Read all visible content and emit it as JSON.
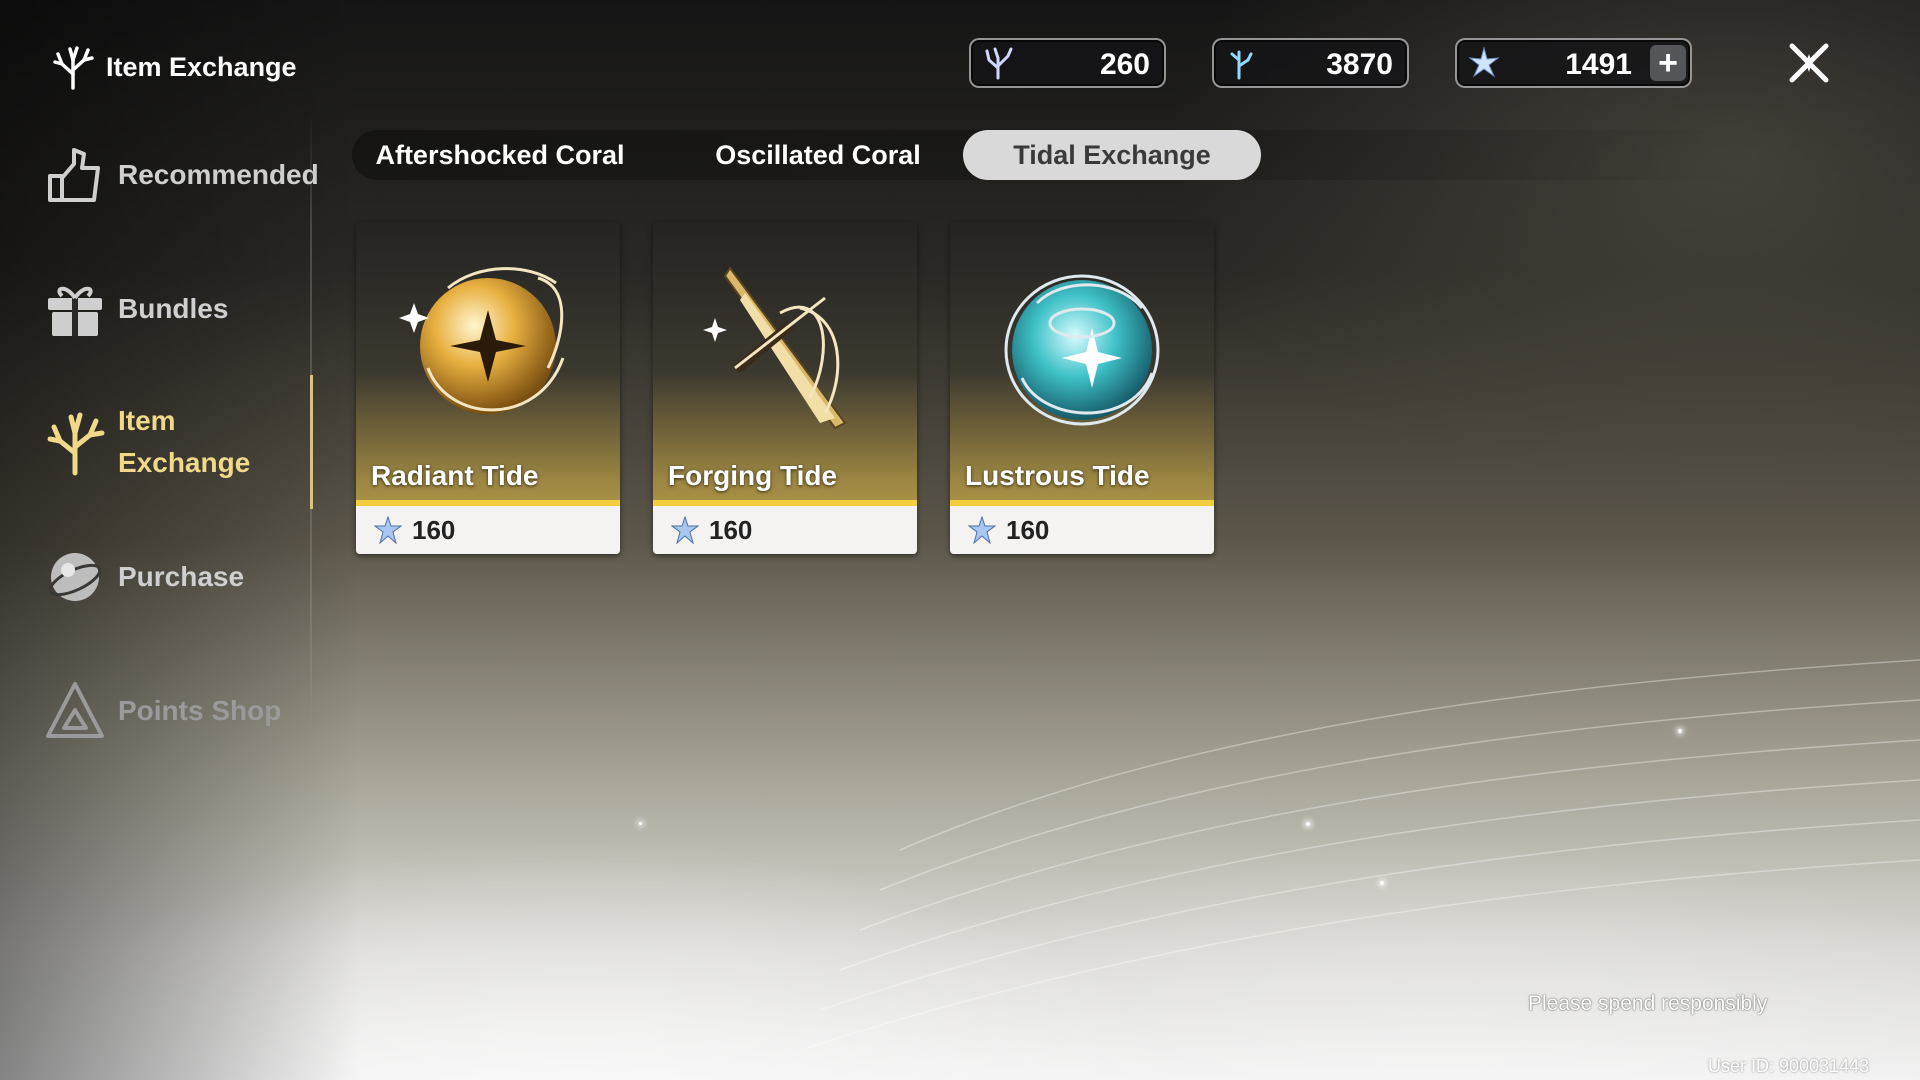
{
  "header": {
    "title": "Item Exchange",
    "close_icon": "close-x-icon"
  },
  "currencies": [
    {
      "icon": "aftershocked-coral-icon",
      "value": "260"
    },
    {
      "icon": "oscillated-coral-icon",
      "value": "3870"
    },
    {
      "icon": "lunite-star-icon",
      "value": "1491",
      "add_label": "+"
    }
  ],
  "sidebar": {
    "items": [
      {
        "label": "Recommended",
        "icon": "recommended-icon"
      },
      {
        "label": "Bundles",
        "icon": "gift-icon"
      },
      {
        "label_line1": "Item",
        "label_line2": "Exchange",
        "icon": "coral-branch-icon",
        "active": true
      },
      {
        "label": "Purchase",
        "icon": "purchase-orb-icon"
      },
      {
        "label": "Points Shop",
        "icon": "triangle-icon"
      }
    ]
  },
  "tabs": [
    {
      "label": "Aftershocked Coral"
    },
    {
      "label": "Oscillated Coral"
    },
    {
      "label": "Tidal Exchange",
      "active": true
    }
  ],
  "items": [
    {
      "name": "Radiant Tide",
      "price": "160",
      "icon": "radiant-tide-orb-icon"
    },
    {
      "name": "Forging Tide",
      "price": "160",
      "icon": "forging-tide-blade-icon"
    },
    {
      "name": "Lustrous Tide",
      "price": "160",
      "icon": "lustrous-tide-orb-icon"
    }
  ],
  "footer": {
    "note": "Please spend responsibly",
    "user_id": "User ID: 900031443"
  },
  "colors": {
    "accent_gold": "#f2cf3e",
    "active_sidebar": "#f1d98a",
    "active_tab_bg": "#d9d9d9"
  }
}
